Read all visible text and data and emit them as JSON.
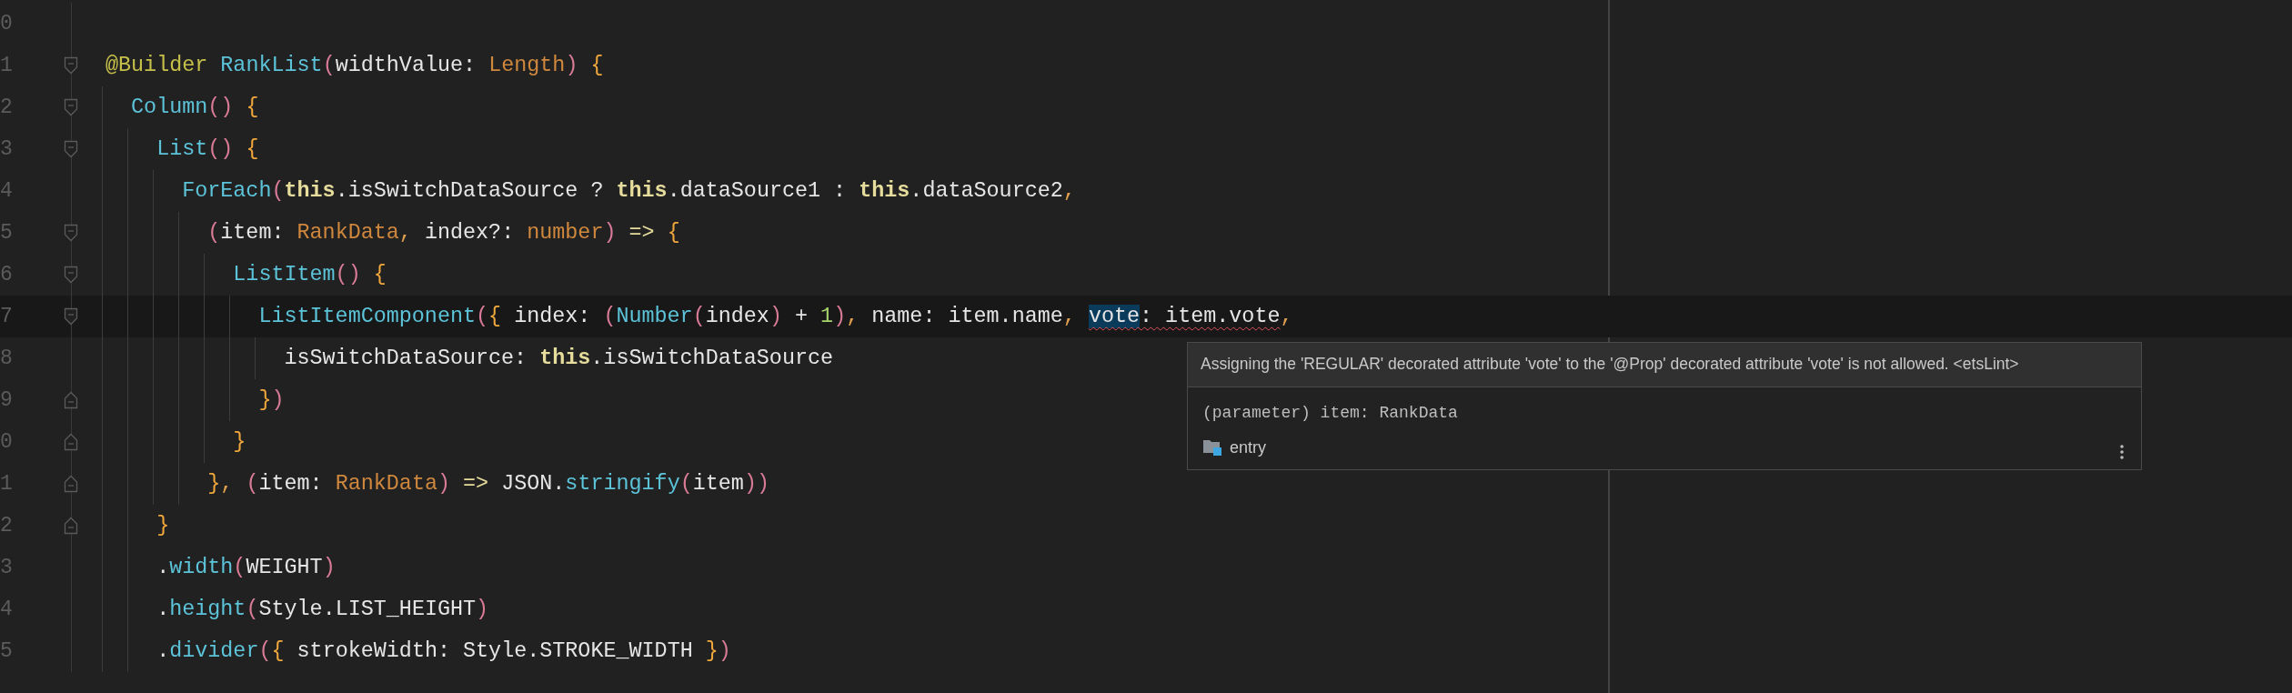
{
  "editor": {
    "lines": [
      {
        "number": "0"
      },
      {
        "number": "1",
        "kind": "fold-start",
        "tokens": [
          {
            "kind": "dec",
            "text": "@Builder"
          },
          {
            "kind": "fn",
            "text": " RankList"
          },
          {
            "kind": "paren",
            "text": "("
          },
          {
            "kind": "id",
            "text": "widthValue: "
          },
          {
            "kind": "type",
            "text": "Length"
          },
          {
            "kind": "paren",
            "text": ")"
          },
          {
            "kind": "brace",
            "text": " {"
          }
        ],
        "children": [
          {
            "number": "2",
            "kind": "fold-start",
            "tokens": [
              {
                "kind": "fn",
                "text": "Column"
              },
              {
                "kind": "paren",
                "text": "()"
              },
              {
                "kind": "brace",
                "text": " {"
              }
            ],
            "children": [
              {
                "number": "3",
                "kind": "fold-start",
                "tokens": [
                  {
                    "kind": "fn",
                    "text": "List"
                  },
                  {
                    "kind": "paren",
                    "text": "()"
                  },
                  {
                    "kind": "brace",
                    "text": " {"
                  }
                ],
                "children": [
                  {
                    "number": "4",
                    "tokens": [
                      {
                        "kind": "fn",
                        "text": "ForEach"
                      },
                      {
                        "kind": "paren",
                        "text": "("
                      },
                      {
                        "kind": "kw",
                        "text": "this"
                      },
                      {
                        "kind": "id",
                        "text": ".isSwitchDataSource ? "
                      },
                      {
                        "kind": "kw",
                        "text": "this"
                      },
                      {
                        "kind": "id",
                        "text": ".dataSource1 : "
                      },
                      {
                        "kind": "kw",
                        "text": "this"
                      },
                      {
                        "kind": "id",
                        "text": ".dataSource2"
                      },
                      {
                        "kind": "comma",
                        "text": ","
                      }
                    ],
                    "children": [
                      {
                        "number": "5",
                        "kind": "fold-start",
                        "tokens": [
                          {
                            "kind": "paren",
                            "text": "("
                          },
                          {
                            "kind": "id",
                            "text": "item: "
                          },
                          {
                            "kind": "type",
                            "text": "RankData"
                          },
                          {
                            "kind": "comma",
                            "text": ","
                          },
                          {
                            "kind": "id",
                            "text": " index?: "
                          },
                          {
                            "kind": "type",
                            "text": "number"
                          },
                          {
                            "kind": "paren",
                            "text": ")"
                          },
                          {
                            "kind": "op",
                            "text": " => "
                          },
                          {
                            "kind": "brace",
                            "text": "{"
                          }
                        ],
                        "children": [
                          {
                            "number": "6",
                            "kind": "fold-start",
                            "tokens": [
                              {
                                "kind": "fn",
                                "text": "ListItem"
                              },
                              {
                                "kind": "paren",
                                "text": "()"
                              },
                              {
                                "kind": "brace",
                                "text": " {"
                              }
                            ],
                            "children": [
                              {
                                "number": "7",
                                "kind": "fold-start",
                                "current": true,
                                "tokens": [
                                  {
                                    "kind": "fn",
                                    "text": "ListItemComponent"
                                  },
                                  {
                                    "kind": "paren",
                                    "text": "("
                                  },
                                  {
                                    "kind": "brace",
                                    "text": "{"
                                  },
                                  {
                                    "kind": "id",
                                    "text": " index: "
                                  },
                                  {
                                    "kind": "paren",
                                    "text": "("
                                  },
                                  {
                                    "kind": "fn",
                                    "text": "Number"
                                  },
                                  {
                                    "kind": "paren",
                                    "text": "("
                                  },
                                  {
                                    "kind": "id",
                                    "text": "index"
                                  },
                                  {
                                    "kind": "paren",
                                    "text": ")"
                                  },
                                  {
                                    "kind": "id",
                                    "text": " + "
                                  },
                                  {
                                    "kind": "num",
                                    "text": "1"
                                  },
                                  {
                                    "kind": "paren",
                                    "text": ")"
                                  },
                                  {
                                    "kind": "comma",
                                    "text": ","
                                  },
                                  {
                                    "kind": "id",
                                    "text": " name: item.name"
                                  },
                                  {
                                    "kind": "comma",
                                    "text": ", "
                                  },
                                  {
                                    "kind": "id",
                                    "text": "vote",
                                    "selected": true,
                                    "error": true
                                  },
                                  {
                                    "kind": "id",
                                    "text": ": item.vote",
                                    "error": true
                                  },
                                  {
                                    "kind": "comma",
                                    "text": ","
                                  }
                                ],
                                "children": [
                                  {
                                    "number": "8",
                                    "tokens": [
                                      {
                                        "kind": "id",
                                        "text": "isSwitchDataSource: "
                                      },
                                      {
                                        "kind": "kw",
                                        "text": "this"
                                      },
                                      {
                                        "kind": "id",
                                        "text": ".isSwitchDataSource"
                                      }
                                    ]
                                  }
                                ]
                              },
                              {
                                "number": "9",
                                "kind": "fold-end",
                                "tokens": [
                                  {
                                    "kind": "brace",
                                    "text": "}"
                                  },
                                  {
                                    "kind": "paren",
                                    "text": ")"
                                  }
                                ]
                              }
                            ]
                          },
                          {
                            "number": "0",
                            "kind": "fold-end",
                            "tokens": [
                              {
                                "kind": "brace",
                                "text": "}"
                              }
                            ]
                          }
                        ]
                      },
                      {
                        "number": "1",
                        "kind": "fold-end",
                        "tokens": [
                          {
                            "kind": "brace",
                            "text": "}"
                          },
                          {
                            "kind": "comma",
                            "text": ","
                          },
                          {
                            "kind": "paren",
                            "text": " ("
                          },
                          {
                            "kind": "id",
                            "text": "item: "
                          },
                          {
                            "kind": "type",
                            "text": "RankData"
                          },
                          {
                            "kind": "paren",
                            "text": ")"
                          },
                          {
                            "kind": "op",
                            "text": " => "
                          },
                          {
                            "kind": "id",
                            "text": "JSON."
                          },
                          {
                            "kind": "fn",
                            "text": "stringify"
                          },
                          {
                            "kind": "paren",
                            "text": "("
                          },
                          {
                            "kind": "id",
                            "text": "item"
                          },
                          {
                            "kind": "paren",
                            "text": "))"
                          }
                        ]
                      }
                    ]
                  }
                ]
              },
              {
                "number": "2",
                "kind": "fold-end",
                "tokens": [
                  {
                    "kind": "brace",
                    "text": "}"
                  }
                ]
              },
              {
                "number": "3",
                "tokens": [
                  {
                    "kind": "id",
                    "text": "."
                  },
                  {
                    "kind": "fn",
                    "text": "width"
                  },
                  {
                    "kind": "paren",
                    "text": "("
                  },
                  {
                    "kind": "id",
                    "text": "WEIGHT"
                  },
                  {
                    "kind": "paren",
                    "text": ")"
                  }
                ]
              },
              {
                "number": "4",
                "tokens": [
                  {
                    "kind": "id",
                    "text": "."
                  },
                  {
                    "kind": "fn",
                    "text": "height"
                  },
                  {
                    "kind": "paren",
                    "text": "("
                  },
                  {
                    "kind": "id",
                    "text": "Style.LIST_HEIGHT"
                  },
                  {
                    "kind": "paren",
                    "text": ")"
                  }
                ]
              },
              {
                "number": "5",
                "tokens": [
                  {
                    "kind": "id",
                    "text": "."
                  },
                  {
                    "kind": "fn",
                    "text": "divider"
                  },
                  {
                    "kind": "paren",
                    "text": "("
                  },
                  {
                    "kind": "brace",
                    "text": "{"
                  },
                  {
                    "kind": "id",
                    "text": " strokeWidth: Style.STROKE_WIDTH "
                  },
                  {
                    "kind": "brace",
                    "text": "}"
                  },
                  {
                    "kind": "paren",
                    "text": ")"
                  }
                ]
              }
            ]
          }
        ]
      }
    ]
  },
  "tooltip": {
    "message": "Assigning the 'REGULAR' decorated attribute 'vote' to the '@Prop' decorated attribute 'vote' is not allowed. <etsLint>",
    "signature": "(parameter) item: RankData",
    "module": "entry"
  }
}
